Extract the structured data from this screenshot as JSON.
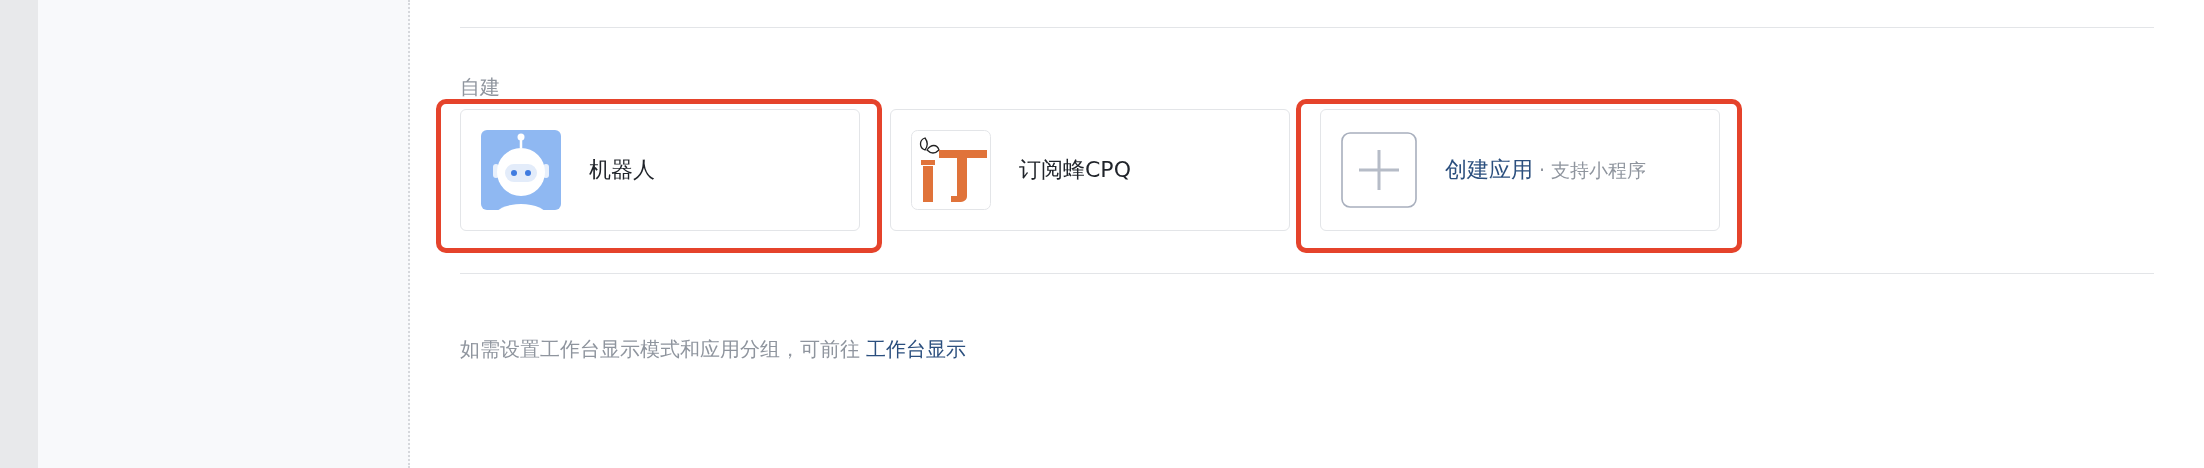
{
  "section_label": "自建",
  "apps": [
    {
      "kind": "robot",
      "name": "机器人",
      "highlighted": true
    },
    {
      "kind": "logo",
      "name": "订阅蜂CPQ",
      "highlighted": false
    },
    {
      "kind": "create",
      "name": "创建应用",
      "note": "· 支持小程序",
      "highlighted": true
    }
  ],
  "footer": {
    "text": "如需设置工作台显示模式和应用分组，可前往",
    "link": "工作台显示"
  }
}
